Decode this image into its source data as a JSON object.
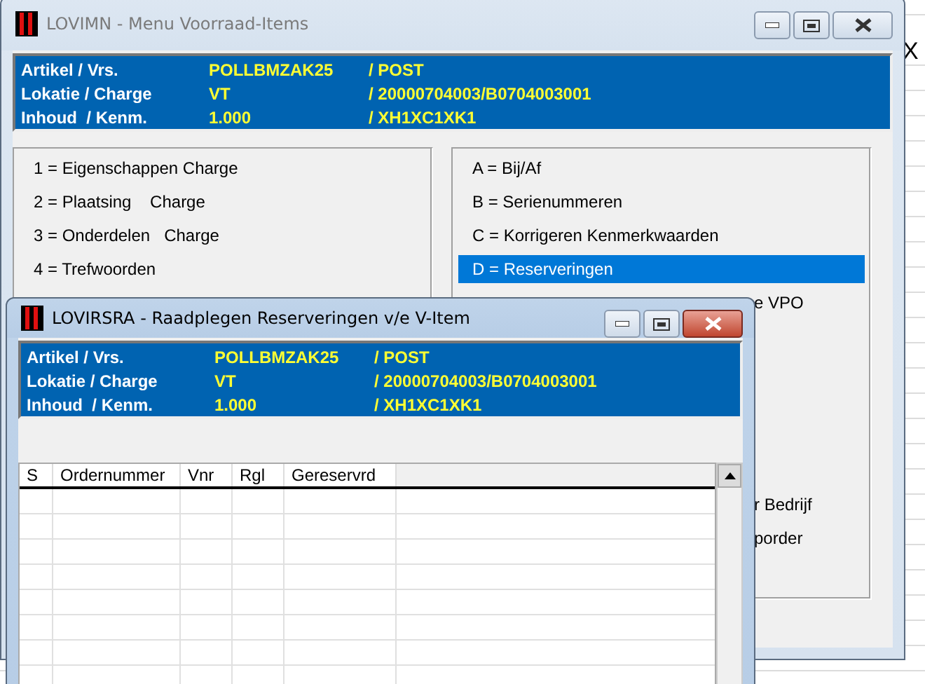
{
  "backdrop": {
    "cell": "X"
  },
  "windows": [
    {
      "title": "LOVIMN - Menu Voorraad-Items",
      "active": false,
      "info": [
        {
          "label": "Artikel / Vrs.",
          "value": "POLLBMZAK25",
          "detail": "/ POST"
        },
        {
          "label": "Lokatie / Charge",
          "value": "VT",
          "detail": "/ 20000704003/B0704003001"
        },
        {
          "label": "Inhoud  / Kenm.",
          "value": "1.000",
          "detail": "/ XH1XC1XK1"
        }
      ],
      "left_menu": [
        {
          "label": "1 = Eigenschappen Charge",
          "selected": false
        },
        {
          "label": "2 = Plaatsing    Charge",
          "selected": false
        },
        {
          "label": "3 = Onderdelen   Charge",
          "selected": false
        },
        {
          "label": "4 = Trefwoorden",
          "selected": false
        }
      ],
      "right_menu": [
        {
          "label": "A = Bij/Af",
          "selected": false,
          "kind": "full"
        },
        {
          "label": "B = Serienummeren",
          "selected": false,
          "kind": "full"
        },
        {
          "label": "C = Korrigeren Kenmerkwaarden",
          "selected": false,
          "kind": "full"
        },
        {
          "label": "D = Reserveringen",
          "selected": true,
          "kind": "full"
        },
        {
          "label": "e VPO",
          "selected": false,
          "kind": "cut"
        },
        {
          "label": "r Bedrijf",
          "selected": false,
          "kind": "cut"
        },
        {
          "label": "porder",
          "selected": false,
          "kind": "cut"
        }
      ]
    },
    {
      "title": "LOVIRSRA - Raadplegen Reserveringen v/e V-Item",
      "active": true,
      "info": [
        {
          "label": "Artikel / Vrs.",
          "value": "POLLBMZAK25",
          "detail": "/ POST"
        },
        {
          "label": "Lokatie / Charge",
          "value": "VT",
          "detail": "/ 20000704003/B0704003001"
        },
        {
          "label": "Inhoud  / Kenm.",
          "value": "1.000",
          "detail": "/ XH1XC1XK1"
        }
      ],
      "table": {
        "columns": [
          "S",
          "Ordernummer",
          "Vnr",
          "Rgl",
          "Gereservrd"
        ]
      }
    }
  ]
}
